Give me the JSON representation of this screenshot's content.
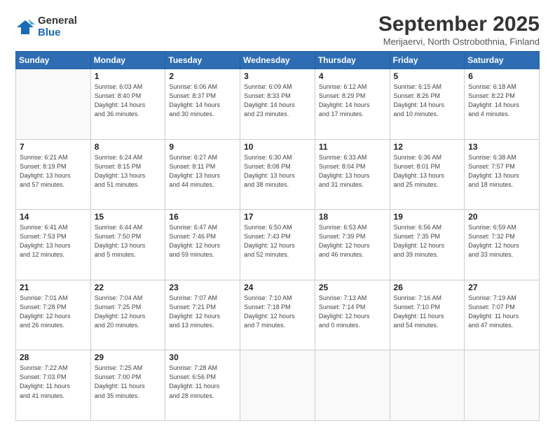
{
  "logo": {
    "general": "General",
    "blue": "Blue"
  },
  "title": "September 2025",
  "location": "Merijaervi, North Ostrobothnia, Finland",
  "weekdays": [
    "Sunday",
    "Monday",
    "Tuesday",
    "Wednesday",
    "Thursday",
    "Friday",
    "Saturday"
  ],
  "weeks": [
    [
      {
        "day": "",
        "info": ""
      },
      {
        "day": "1",
        "info": "Sunrise: 6:03 AM\nSunset: 8:40 PM\nDaylight: 14 hours\nand 36 minutes."
      },
      {
        "day": "2",
        "info": "Sunrise: 6:06 AM\nSunset: 8:37 PM\nDaylight: 14 hours\nand 30 minutes."
      },
      {
        "day": "3",
        "info": "Sunrise: 6:09 AM\nSunset: 8:33 PM\nDaylight: 14 hours\nand 23 minutes."
      },
      {
        "day": "4",
        "info": "Sunrise: 6:12 AM\nSunset: 8:29 PM\nDaylight: 14 hours\nand 17 minutes."
      },
      {
        "day": "5",
        "info": "Sunrise: 6:15 AM\nSunset: 8:26 PM\nDaylight: 14 hours\nand 10 minutes."
      },
      {
        "day": "6",
        "info": "Sunrise: 6:18 AM\nSunset: 8:22 PM\nDaylight: 14 hours\nand 4 minutes."
      }
    ],
    [
      {
        "day": "7",
        "info": "Sunrise: 6:21 AM\nSunset: 8:19 PM\nDaylight: 13 hours\nand 57 minutes."
      },
      {
        "day": "8",
        "info": "Sunrise: 6:24 AM\nSunset: 8:15 PM\nDaylight: 13 hours\nand 51 minutes."
      },
      {
        "day": "9",
        "info": "Sunrise: 6:27 AM\nSunset: 8:11 PM\nDaylight: 13 hours\nand 44 minutes."
      },
      {
        "day": "10",
        "info": "Sunrise: 6:30 AM\nSunset: 8:08 PM\nDaylight: 13 hours\nand 38 minutes."
      },
      {
        "day": "11",
        "info": "Sunrise: 6:33 AM\nSunset: 8:04 PM\nDaylight: 13 hours\nand 31 minutes."
      },
      {
        "day": "12",
        "info": "Sunrise: 6:36 AM\nSunset: 8:01 PM\nDaylight: 13 hours\nand 25 minutes."
      },
      {
        "day": "13",
        "info": "Sunrise: 6:38 AM\nSunset: 7:57 PM\nDaylight: 13 hours\nand 18 minutes."
      }
    ],
    [
      {
        "day": "14",
        "info": "Sunrise: 6:41 AM\nSunset: 7:53 PM\nDaylight: 13 hours\nand 12 minutes."
      },
      {
        "day": "15",
        "info": "Sunrise: 6:44 AM\nSunset: 7:50 PM\nDaylight: 13 hours\nand 5 minutes."
      },
      {
        "day": "16",
        "info": "Sunrise: 6:47 AM\nSunset: 7:46 PM\nDaylight: 12 hours\nand 59 minutes."
      },
      {
        "day": "17",
        "info": "Sunrise: 6:50 AM\nSunset: 7:43 PM\nDaylight: 12 hours\nand 52 minutes."
      },
      {
        "day": "18",
        "info": "Sunrise: 6:53 AM\nSunset: 7:39 PM\nDaylight: 12 hours\nand 46 minutes."
      },
      {
        "day": "19",
        "info": "Sunrise: 6:56 AM\nSunset: 7:35 PM\nDaylight: 12 hours\nand 39 minutes."
      },
      {
        "day": "20",
        "info": "Sunrise: 6:59 AM\nSunset: 7:32 PM\nDaylight: 12 hours\nand 33 minutes."
      }
    ],
    [
      {
        "day": "21",
        "info": "Sunrise: 7:01 AM\nSunset: 7:28 PM\nDaylight: 12 hours\nand 26 minutes."
      },
      {
        "day": "22",
        "info": "Sunrise: 7:04 AM\nSunset: 7:25 PM\nDaylight: 12 hours\nand 20 minutes."
      },
      {
        "day": "23",
        "info": "Sunrise: 7:07 AM\nSunset: 7:21 PM\nDaylight: 12 hours\nand 13 minutes."
      },
      {
        "day": "24",
        "info": "Sunrise: 7:10 AM\nSunset: 7:18 PM\nDaylight: 12 hours\nand 7 minutes."
      },
      {
        "day": "25",
        "info": "Sunrise: 7:13 AM\nSunset: 7:14 PM\nDaylight: 12 hours\nand 0 minutes."
      },
      {
        "day": "26",
        "info": "Sunrise: 7:16 AM\nSunset: 7:10 PM\nDaylight: 11 hours\nand 54 minutes."
      },
      {
        "day": "27",
        "info": "Sunrise: 7:19 AM\nSunset: 7:07 PM\nDaylight: 11 hours\nand 47 minutes."
      }
    ],
    [
      {
        "day": "28",
        "info": "Sunrise: 7:22 AM\nSunset: 7:03 PM\nDaylight: 11 hours\nand 41 minutes."
      },
      {
        "day": "29",
        "info": "Sunrise: 7:25 AM\nSunset: 7:00 PM\nDaylight: 11 hours\nand 35 minutes."
      },
      {
        "day": "30",
        "info": "Sunrise: 7:28 AM\nSunset: 6:56 PM\nDaylight: 11 hours\nand 28 minutes."
      },
      {
        "day": "",
        "info": ""
      },
      {
        "day": "",
        "info": ""
      },
      {
        "day": "",
        "info": ""
      },
      {
        "day": "",
        "info": ""
      }
    ]
  ]
}
